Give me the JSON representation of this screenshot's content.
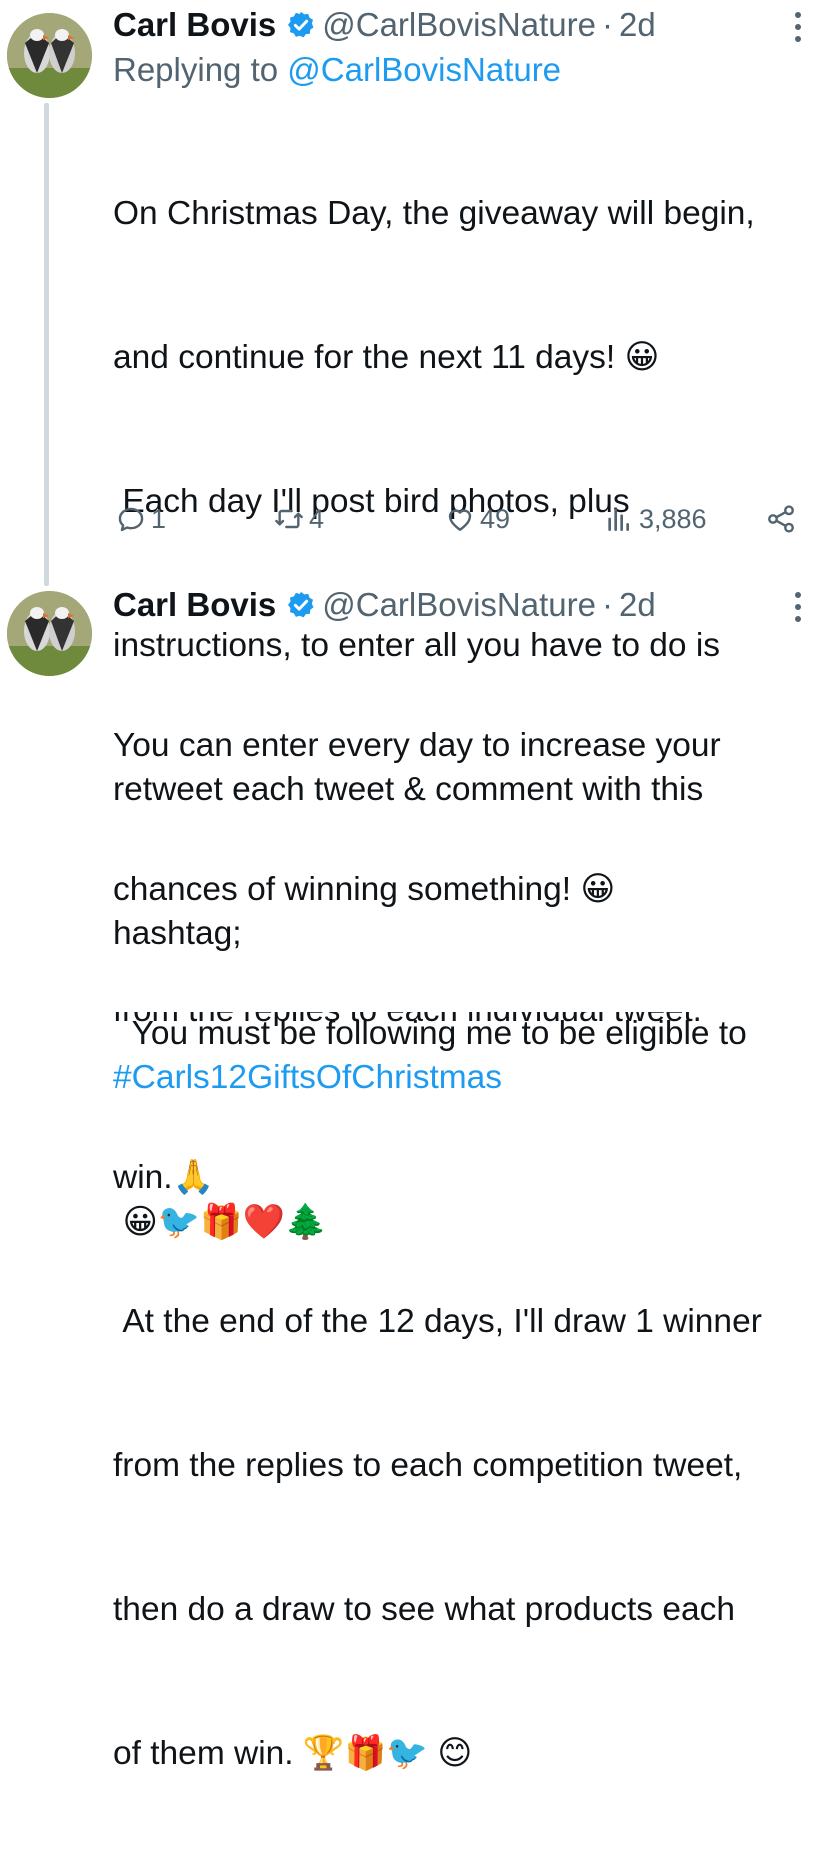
{
  "tweets": [
    {
      "author_name": "Carl Bovis",
      "handle": "@CarlBovisNature",
      "separator": "·",
      "time": "2d",
      "replying_label": "Replying to",
      "replying_handle": "@CarlBovisNature",
      "lines": [
        "On Christmas Day, the giveaway will begin,",
        "and continue for the next 11 days! 😀",
        " Each day I'll post bird photos, plus",
        "instructions, to enter all you have to do is",
        "retweet each tweet & comment with this",
        "hashtag;"
      ],
      "hashtag": "#Carls12GiftsOfChristmas",
      "emoji_line": " 😀🐦🎁❤️🌲",
      "stats": {
        "replies": "1",
        "retweets": "4",
        "likes": "49",
        "views": "3,886"
      }
    },
    {
      "author_name": "Carl Bovis",
      "handle": "@CarlBovisNature",
      "separator": "·",
      "time": "2d",
      "lines": [
        "You can enter every day to increase your",
        "chances of winning something! 😀",
        "  You must be following me to be eligible to",
        "win.🙏",
        " At the end of the 12 days, I'll draw 1 winner",
        "from the replies to each competition tweet,",
        "then do a draw to see what products each",
        "of them win. 🏆🎁🐦 😊",
        "from the replies to each individual tweet."
      ]
    }
  ],
  "colors": {
    "accent": "#1d9bf0",
    "secondary_text": "#536471",
    "thread_line": "#cfd9de"
  },
  "icons": [
    "verified-badge-icon",
    "more-icon",
    "reply-icon",
    "retweet-icon",
    "like-icon",
    "views-icon",
    "share-icon"
  ]
}
